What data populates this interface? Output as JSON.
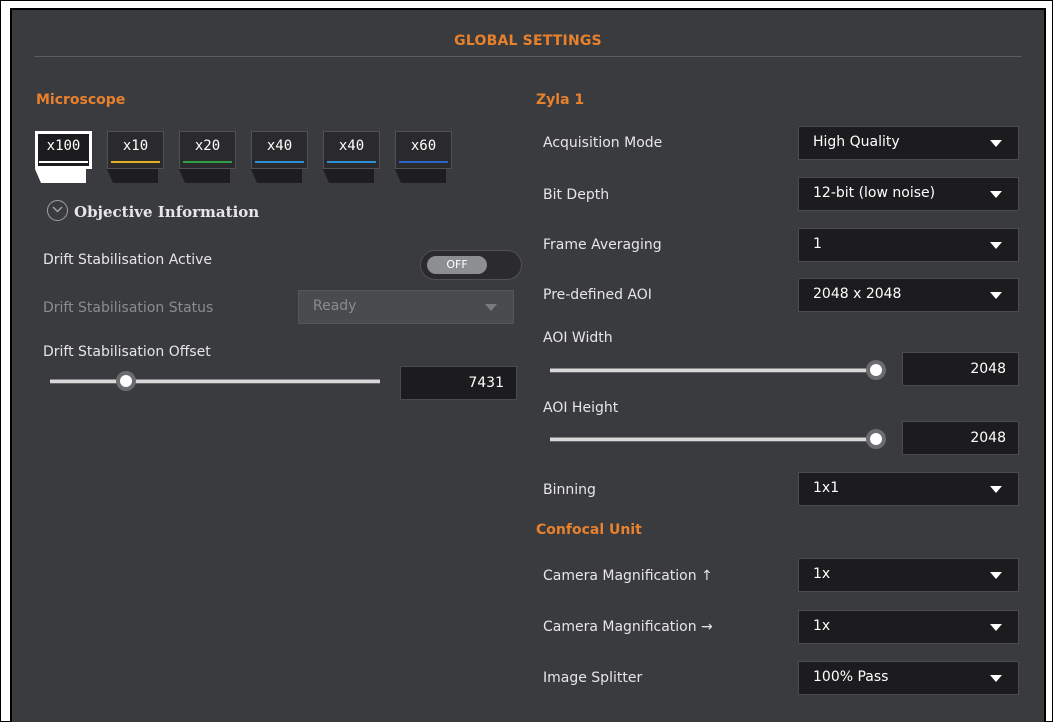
{
  "header": {
    "title": "GLOBAL SETTINGS"
  },
  "microscope": {
    "title": "Microscope",
    "objectives": [
      {
        "label": "x100",
        "color": "#ffffff",
        "selected": true
      },
      {
        "label": "x10",
        "color": "#e5b020"
      },
      {
        "label": "x20",
        "color": "#2ea043"
      },
      {
        "label": "x40",
        "color": "#2d8fd6"
      },
      {
        "label": "x40",
        "color": "#2d8fd6"
      },
      {
        "label": "x60",
        "color": "#2c62c8"
      }
    ],
    "objective_info_label": "Objective Information",
    "drift_active_label": "Drift Stabilisation Active",
    "drift_active_toggle": "OFF",
    "drift_status_label": "Drift Stabilisation Status",
    "drift_status_value": "Ready",
    "drift_offset_label": "Drift Stabilisation Offset",
    "drift_offset_value": "7431",
    "drift_offset_fraction": 0.23
  },
  "zyla": {
    "title": "Zyla 1",
    "acquisition_mode": {
      "label": "Acquisition Mode",
      "value": "High Quality"
    },
    "bit_depth": {
      "label": "Bit Depth",
      "value": "12-bit (low noise)"
    },
    "frame_averaging": {
      "label": "Frame Averaging",
      "value": "1"
    },
    "predefined_aoi": {
      "label": "Pre-defined AOI",
      "value": "2048 x 2048"
    },
    "aoi_width": {
      "label": "AOI Width",
      "value": "2048",
      "fraction": 1.0
    },
    "aoi_height": {
      "label": "AOI Height",
      "value": "2048",
      "fraction": 1.0
    },
    "binning": {
      "label": "Binning",
      "value": "1x1"
    }
  },
  "confocal": {
    "title": "Confocal Unit",
    "cam_mag_up": {
      "label": "Camera Magnification ↑",
      "value": "1x"
    },
    "cam_mag_right": {
      "label": "Camera Magnification →",
      "value": "1x"
    },
    "image_splitter": {
      "label": "Image Splitter",
      "value": "100% Pass"
    }
  },
  "colors": {
    "accent": "#e8812d",
    "panel": "#3a3b3e"
  }
}
